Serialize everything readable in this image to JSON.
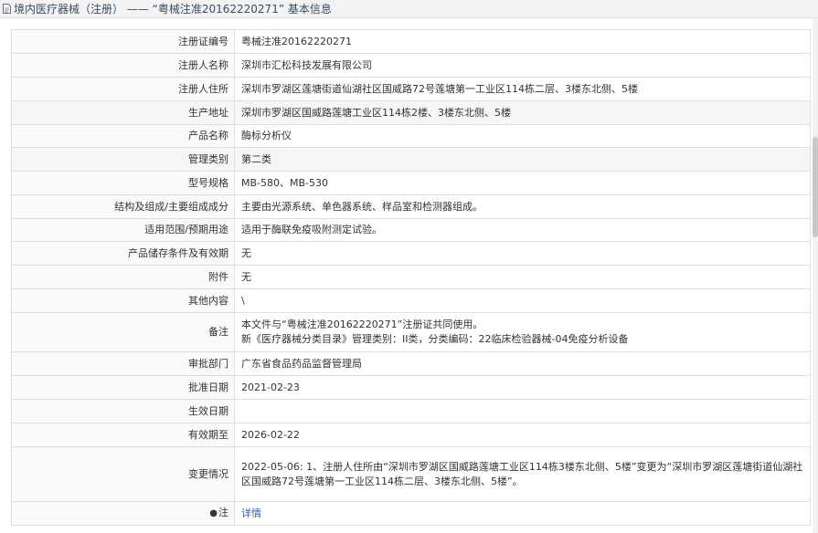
{
  "header": {
    "title": "境内医疗器械（注册） —— “粤械注准20162220271” 基本信息"
  },
  "rows": [
    {
      "label": "注册证编号",
      "value": "粤械注准20162220271"
    },
    {
      "label": "注册人名称",
      "value": "深圳市汇松科技发展有限公司"
    },
    {
      "label": "注册人住所",
      "value": "深圳市罗湖区莲塘街道仙湖社区国威路72号莲塘第一工业区114栋二层、3楼东北侧、5楼"
    },
    {
      "label": "生产地址",
      "value": "深圳市罗湖区国威路莲塘工业区114栋2楼、3楼东北侧、5楼"
    },
    {
      "label": "产品名称",
      "value": "酶标分析仪"
    },
    {
      "label": "管理类别",
      "value": "第二类"
    },
    {
      "label": "型号规格",
      "value": "MB-580、MB-530"
    },
    {
      "label": "结构及组成/主要组成成分",
      "value": "主要由光源系统、单色器系统、样品室和检测器组成。"
    },
    {
      "label": "适用范围/预期用途",
      "value": "适用于酶联免疫吸附测定试验。"
    },
    {
      "label": "产品储存条件及有效期",
      "value": "无"
    },
    {
      "label": "附件",
      "value": "无"
    },
    {
      "label": "其他内容",
      "value": "\\"
    },
    {
      "label": "备注",
      "value_line1": "本文件与“粤械注准20162220271”注册证共同使用。",
      "value_line2": "新《医疗器械分类目录》管理类别：II类，分类编码：22临床检验器械-04免疫分析设备"
    },
    {
      "label": "审批部门",
      "value": "广东省食品药品监督管理局"
    },
    {
      "label": "批准日期",
      "value": "2021-02-23"
    },
    {
      "label": "生效日期",
      "value": ""
    },
    {
      "label": "有效期至",
      "value": "2026-02-22"
    },
    {
      "label": "变更情况",
      "value": "2022-05-06: 1、注册人住所由“深圳市罗湖区国威路莲塘工业区114栋3楼东北侧、5楼”变更为“深圳市罗湖区莲塘街道仙湖社区国威路72号莲塘第一工业区114栋二层、3楼东北侧、5楼”。"
    },
    {
      "label": "注",
      "value": "详情"
    }
  ]
}
